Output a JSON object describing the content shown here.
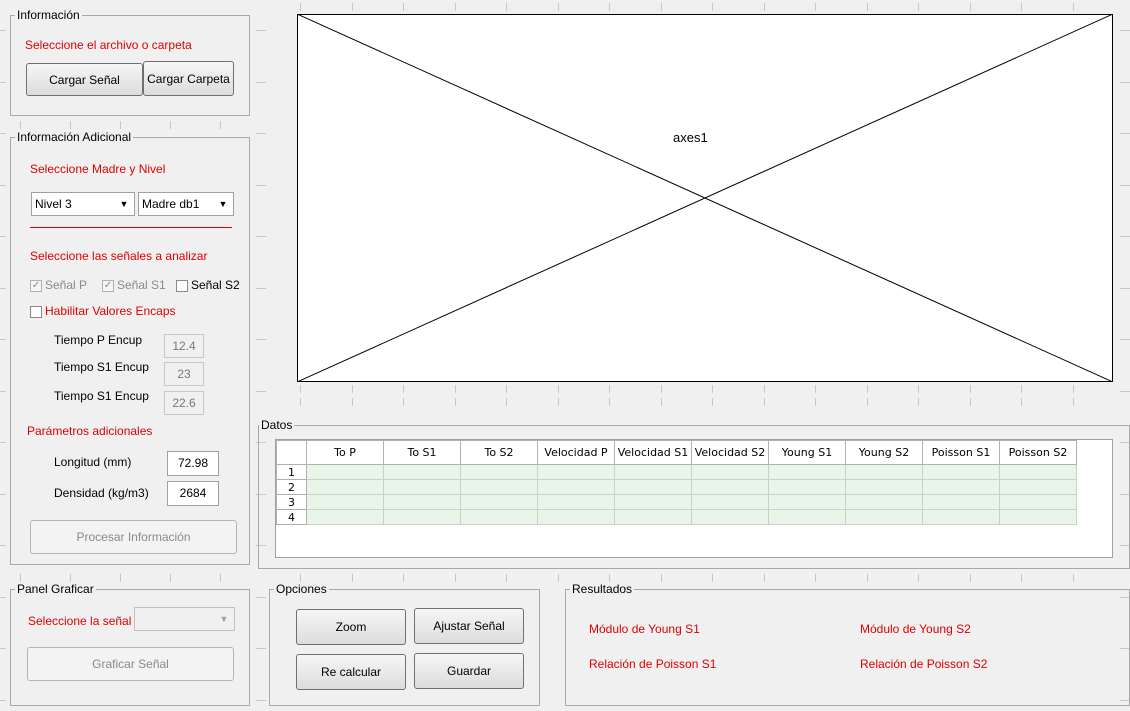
{
  "informacion": {
    "title": "Información",
    "instruction": "Seleccione el archivo o carpeta",
    "load_signal": "Cargar Señal",
    "load_folder": "Cargar Carpeta"
  },
  "adicional": {
    "title": "Información Adicional",
    "select_instruction": "Seleccione Madre y Nivel",
    "nivel_value": "Nivel 3",
    "madre_value": "Madre db1",
    "signals_instruction": "Seleccione las señales a analizar",
    "check_p": "Señal P",
    "check_s1": "Señal S1",
    "check_s2": "Señal S2",
    "enable_encaps": "Habilitar Valores Encaps",
    "tiempo_p_label": "Tiempo P Encup",
    "tiempo_p_value": "12.4",
    "tiempo_s1_label": "Tiempo S1 Encup",
    "tiempo_s1_value": "23",
    "tiempo_s2_label": "Tiempo S1 Encup",
    "tiempo_s2_value": "22.6",
    "params_title": "Parámetros adicionales",
    "longitud_label": "Longitud (mm)",
    "longitud_value": "72.98",
    "densidad_label": "Densidad (kg/m3)",
    "densidad_value": "2684",
    "process_button": "Procesar Información"
  },
  "graficar": {
    "title": "Panel Graficar",
    "select_label": "Seleccione la señal",
    "select_value": "",
    "graph_button": "Graficar Señal"
  },
  "axes": {
    "label": "axes1"
  },
  "datos": {
    "title": "Datos",
    "columns": [
      "To P",
      "To S1",
      "To S2",
      "Velocidad P",
      "Velocidad S1",
      "Velocidad S2",
      "Young S1",
      "Young S2",
      "Poisson S1",
      "Poisson S2"
    ],
    "rows": [
      "1",
      "2",
      "3",
      "4"
    ]
  },
  "opciones": {
    "title": "Opciones",
    "zoom": "Zoom",
    "adjust": "Ajustar Señal",
    "recalc": "Re calcular",
    "save": "Guardar"
  },
  "resultados": {
    "title": "Resultados",
    "young_s1": "Módulo de Young S1",
    "young_s2": "Módulo de Young S2",
    "poisson_s1": "Relación de Poisson S1",
    "poisson_s2": "Relación de Poisson S2"
  },
  "colors": {
    "label_red": "#e00000",
    "table_cell": "#e8f5e8"
  }
}
